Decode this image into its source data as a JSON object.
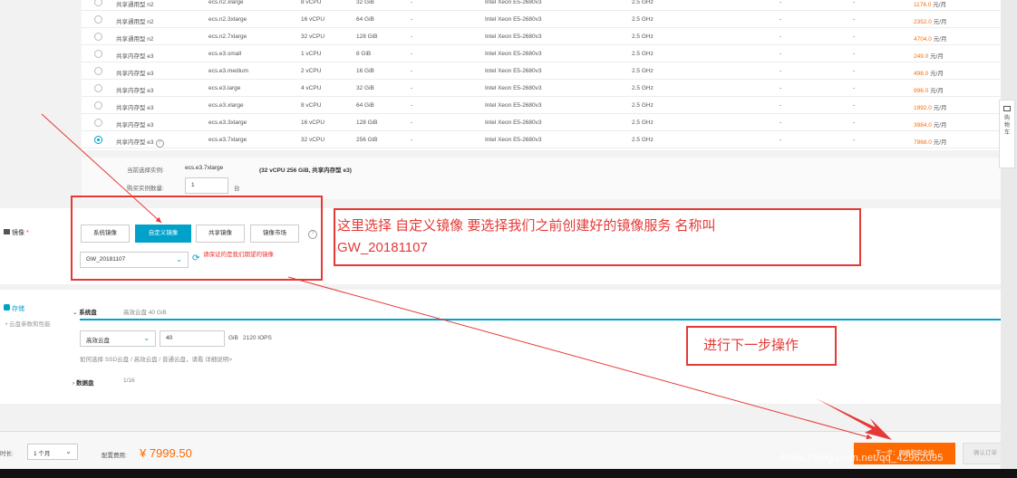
{
  "instances": [
    {
      "family": "共享通用型 n2",
      "spec": "ecs.n2.xlarge",
      "vcpu": "8 vCPU",
      "mem": "32 GiB",
      "dash": "-",
      "cpu": "Intel Xeon E5-2680v3",
      "freq": "2.5 GHz",
      "d1": "-",
      "d2": "-",
      "price": "1176.0",
      "unit": " 元/月",
      "selected": false
    },
    {
      "family": "共享通用型 n2",
      "spec": "ecs.n2.3xlarge",
      "vcpu": "16 vCPU",
      "mem": "64 GiB",
      "dash": "-",
      "cpu": "Intel Xeon E5-2680v3",
      "freq": "2.5 GHz",
      "d1": "-",
      "d2": "-",
      "price": "2352.0",
      "unit": " 元/月",
      "selected": false
    },
    {
      "family": "共享通用型 n2",
      "spec": "ecs.n2.7xlarge",
      "vcpu": "32 vCPU",
      "mem": "128 GiB",
      "dash": "-",
      "cpu": "Intel Xeon E5-2680v3",
      "freq": "2.5 GHz",
      "d1": "-",
      "d2": "-",
      "price": "4704.0",
      "unit": " 元/月",
      "selected": false
    },
    {
      "family": "共享内存型 e3",
      "spec": "ecs.e3.small",
      "vcpu": "1 vCPU",
      "mem": "8 GiB",
      "dash": "-",
      "cpu": "Intel Xeon E5-2680v3",
      "freq": "2.5 GHz",
      "d1": "-",
      "d2": "-",
      "price": "249.0",
      "unit": " 元/月",
      "selected": false
    },
    {
      "family": "共享内存型 e3",
      "spec": "ecs.e3.medium",
      "vcpu": "2 vCPU",
      "mem": "16 GiB",
      "dash": "-",
      "cpu": "Intel Xeon E5-2680v3",
      "freq": "2.5 GHz",
      "d1": "-",
      "d2": "-",
      "price": "498.0",
      "unit": " 元/月",
      "selected": false
    },
    {
      "family": "共享内存型 e3",
      "spec": "ecs.e3.large",
      "vcpu": "4 vCPU",
      "mem": "32 GiB",
      "dash": "-",
      "cpu": "Intel Xeon E5-2680v3",
      "freq": "2.5 GHz",
      "d1": "-",
      "d2": "-",
      "price": "996.0",
      "unit": " 元/月",
      "selected": false
    },
    {
      "family": "共享内存型 e3",
      "spec": "ecs.e3.xlarge",
      "vcpu": "8 vCPU",
      "mem": "64 GiB",
      "dash": "-",
      "cpu": "Intel Xeon E5-2680v3",
      "freq": "2.5 GHz",
      "d1": "-",
      "d2": "-",
      "price": "1992.0",
      "unit": " 元/月",
      "selected": false
    },
    {
      "family": "共享内存型 e3",
      "spec": "ecs.e3.3xlarge",
      "vcpu": "16 vCPU",
      "mem": "128 GiB",
      "dash": "-",
      "cpu": "Intel Xeon E5-2680v3",
      "freq": "2.5 GHz",
      "d1": "-",
      "d2": "-",
      "price": "3984.0",
      "unit": " 元/月",
      "selected": false
    },
    {
      "family": "共享内存型 e3",
      "spec": "ecs.e3.7xlarge",
      "vcpu": "32 vCPU",
      "mem": "256 GiB",
      "dash": "-",
      "cpu": "Intel Xeon E5-2680v3",
      "freq": "2.5 GHz",
      "d1": "-",
      "d2": "-",
      "price": "7968.0",
      "unit": " 元/月",
      "selected": true
    }
  ],
  "summary": {
    "current_label": "当前选择实例:",
    "current_spec": "ecs.e3.7xlarge",
    "current_desc": "(32 vCPU 256 GiB, 共享内存型 e3)",
    "qty_label": "购买实例数量:",
    "qty_value": "1",
    "qty_unit": "台"
  },
  "side_float": {
    "line1": "购",
    "line2": "物",
    "line3": "车"
  },
  "image_section": {
    "title": "镜像",
    "required": "*",
    "tabs": [
      "系统镜像",
      "自定义镜像",
      "共享镜像",
      "镜像市场"
    ],
    "active_tab": 1,
    "selected_image": "GW_20181107",
    "warning": "请保证的是我们期望的镜像"
  },
  "storage_section": {
    "title": "存储",
    "subtitle": "云盘参数和性能",
    "system_disk_label": "系统盘",
    "system_disk_info": "高效云盘  40 GiB",
    "disk_type": "高效云盘",
    "disk_size": "40",
    "disk_unit": "GiB",
    "iops": "2120 IOPS",
    "hint": "如何选择 SSD云盘 / 高效云盘 / 普通云盘，请看 详细说明>",
    "data_disk_label": "数据盘",
    "data_disk_count": "1/16"
  },
  "footer": {
    "duration_label": "时长:",
    "duration_value": "1 个月",
    "fee_label": "配置费用:",
    "fee_value": "¥ 7999.50",
    "next_button": "下一步：网络和安全组",
    "confirm_button": "确认订单"
  },
  "annotations": {
    "image_note_line1": "这里选择  自定义镜像     要选择我们之前创建好的镜像服务  名称叫",
    "image_note_line2": "GW_20181107",
    "next_note": "进行下一步操作"
  },
  "watermark": "https://blog.csdn.net/qq_42962095",
  "colors": {
    "accent": "#00a2ca",
    "orange": "#ff6a00",
    "annotation": "#e53935"
  }
}
